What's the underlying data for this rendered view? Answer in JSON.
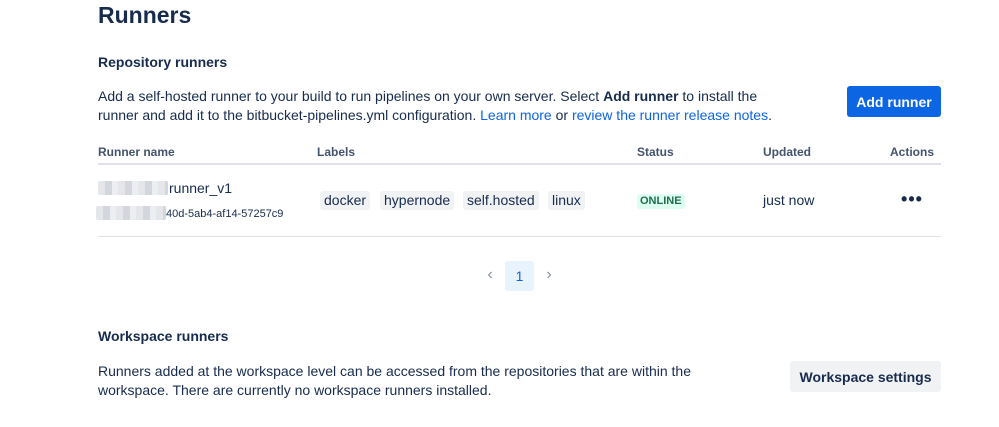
{
  "page": {
    "title": "Runners"
  },
  "repository_runners": {
    "heading": "Repository runners",
    "description_part1": "Add a self-hosted runner to your build to run pipelines on your own server. Select ",
    "description_bold": "Add runner",
    "description_part2": " to install the runner and add it to the bitbucket-pipelines.yml configuration. ",
    "learn_more_link": "Learn more",
    "or_text": " or ",
    "release_notes_link": "review the runner release notes",
    "period": ".",
    "add_button": "Add runner",
    "table": {
      "columns": [
        "Runner name",
        "Labels",
        "Status",
        "Updated",
        "Actions"
      ],
      "rows": [
        {
          "name": "runner_v1",
          "id_suffix": "40d-5ab4-af14-57257c9",
          "labels": [
            "docker",
            "hypernode",
            "self.hosted",
            "linux"
          ],
          "status": "ONLINE",
          "updated": "just now",
          "actions_icon": "more-horizontal-icon"
        }
      ]
    },
    "pagination": {
      "current_page": "1",
      "prev_icon": "chevron-left-icon",
      "next_icon": "chevron-right-icon"
    }
  },
  "workspace_runners": {
    "heading": "Workspace runners",
    "description": "Runners added at the workspace level can be accessed from the repositories that are within the workspace. There are currently no workspace runners installed.",
    "settings_button": "Workspace settings"
  },
  "colors": {
    "primary": "#0c66e4",
    "text": "#172b4d",
    "status_online_bg": "#dcfff1",
    "status_online_text": "#216e4e",
    "label_bg": "#f1f2f4"
  }
}
